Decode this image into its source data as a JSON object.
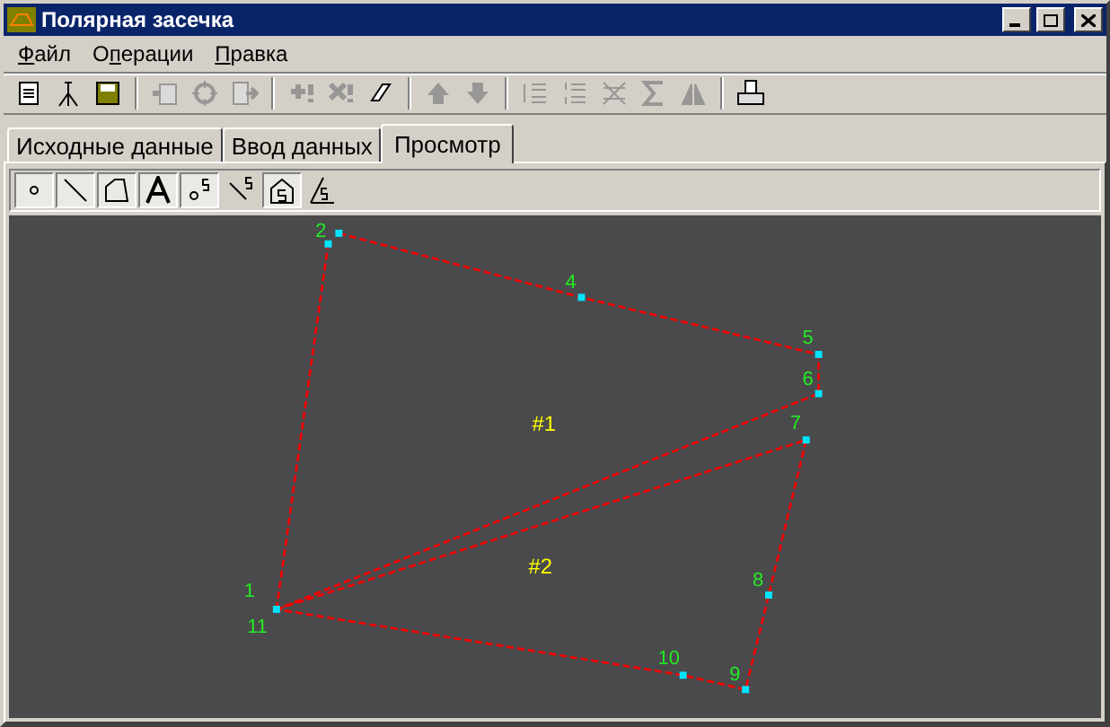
{
  "window": {
    "title": "Полярная засечка"
  },
  "menu": [
    {
      "accel": "Ф",
      "after": "айл"
    },
    {
      "before": "О",
      "accel": "п",
      "after": "ерации"
    },
    {
      "accel": "П",
      "after": "равка"
    }
  ],
  "toolbar": [
    {
      "kind": "new",
      "disabled": false
    },
    {
      "kind": "tripod",
      "disabled": false
    },
    {
      "kind": "save",
      "disabled": false
    },
    {
      "kind": "sep"
    },
    {
      "kind": "paste",
      "disabled": true
    },
    {
      "kind": "target",
      "disabled": true
    },
    {
      "kind": "forward",
      "disabled": true
    },
    {
      "kind": "sep"
    },
    {
      "kind": "add",
      "disabled": true
    },
    {
      "kind": "remove",
      "disabled": true
    },
    {
      "kind": "eraser",
      "disabled": false
    },
    {
      "kind": "sep"
    },
    {
      "kind": "up",
      "disabled": true
    },
    {
      "kind": "down",
      "disabled": true
    },
    {
      "kind": "sep"
    },
    {
      "kind": "list",
      "disabled": true
    },
    {
      "kind": "numlist",
      "disabled": true
    },
    {
      "kind": "cross",
      "disabled": true
    },
    {
      "kind": "sigma",
      "disabled": true
    },
    {
      "kind": "mirror",
      "disabled": true
    },
    {
      "kind": "sep"
    },
    {
      "kind": "print",
      "disabled": false
    }
  ],
  "tabs": [
    {
      "label": "Исходные данные",
      "selected": false
    },
    {
      "label": "Ввод данных",
      "selected": false
    },
    {
      "label": "Просмотр",
      "selected": true
    }
  ],
  "tools": [
    {
      "kind": "point",
      "pressed": true
    },
    {
      "kind": "line",
      "pressed": true
    },
    {
      "kind": "polygon",
      "pressed": true
    },
    {
      "kind": "text",
      "pressed": true
    },
    {
      "kind": "point-number",
      "pressed": true
    },
    {
      "kind": "line-number",
      "pressed": false
    },
    {
      "kind": "polygon-number",
      "pressed": true
    },
    {
      "kind": "angle",
      "pressed": false
    }
  ],
  "canvas": {
    "points": [
      {
        "label": "1"
      },
      {
        "label": "11"
      },
      {
        "label": "2"
      },
      {
        "label": "4"
      },
      {
        "label": "5"
      },
      {
        "label": "6"
      },
      {
        "label": "7"
      },
      {
        "label": "8"
      },
      {
        "label": "9"
      },
      {
        "label": "10"
      }
    ],
    "polygons": [
      {
        "label": "#1"
      },
      {
        "label": "#2"
      }
    ]
  }
}
